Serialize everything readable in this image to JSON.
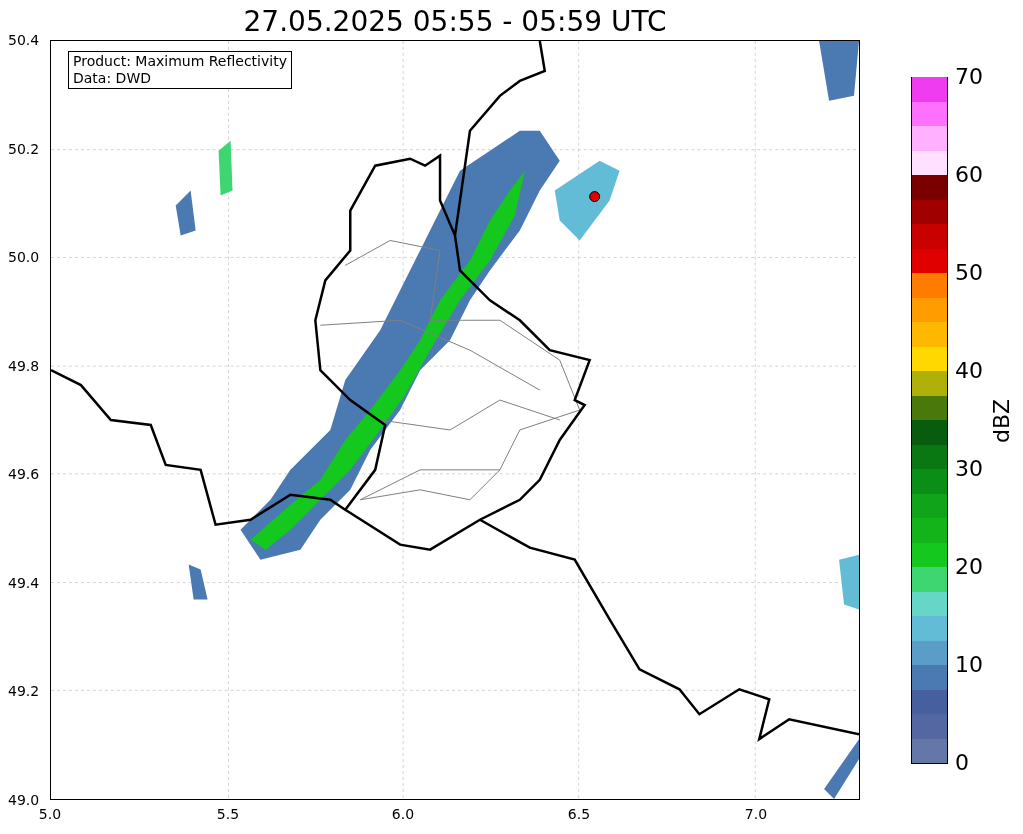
{
  "title": "27.05.2025 05:55 - 05:59 UTC",
  "legend": [
    "Product: Maximum Reflectivity",
    "Data: DWD"
  ],
  "axes": {
    "xticks": [
      "5.0",
      "5.5",
      "6.0",
      "6.5",
      "7.0"
    ],
    "yticks": [
      "50.4",
      "50.2",
      "50.0",
      "49.8",
      "49.6",
      "49.4",
      "49.2",
      "49.0"
    ]
  },
  "colorbar": {
    "label": "dBZ",
    "ticks": [
      "70",
      "60",
      "50",
      "40",
      "30",
      "20",
      "10",
      "0"
    ],
    "segments": [
      {
        "color": "#6477a8"
      },
      {
        "color": "#5567a2"
      },
      {
        "color": "#455f9f"
      },
      {
        "color": "#4b79b1"
      },
      {
        "color": "#5a9ec8"
      },
      {
        "color": "#62bcd6"
      },
      {
        "color": "#66d6c6"
      },
      {
        "color": "#3dd670"
      },
      {
        "color": "#14c81e"
      },
      {
        "color": "#12b41a"
      },
      {
        "color": "#0fa41a"
      },
      {
        "color": "#0b8e15"
      },
      {
        "color": "#097812"
      },
      {
        "color": "#075c0e"
      },
      {
        "color": "#4a780a"
      },
      {
        "color": "#b0b00a"
      },
      {
        "color": "#ffd800"
      },
      {
        "color": "#ffb800"
      },
      {
        "color": "#ff9c00"
      },
      {
        "color": "#ff7c00"
      },
      {
        "color": "#e00000"
      },
      {
        "color": "#c80000"
      },
      {
        "color": "#a00000"
      },
      {
        "color": "#7a0000"
      },
      {
        "color": "#ffe0ff"
      },
      {
        "color": "#ffb0ff"
      },
      {
        "color": "#ff70ff"
      },
      {
        "color": "#f03cf0"
      }
    ]
  }
}
